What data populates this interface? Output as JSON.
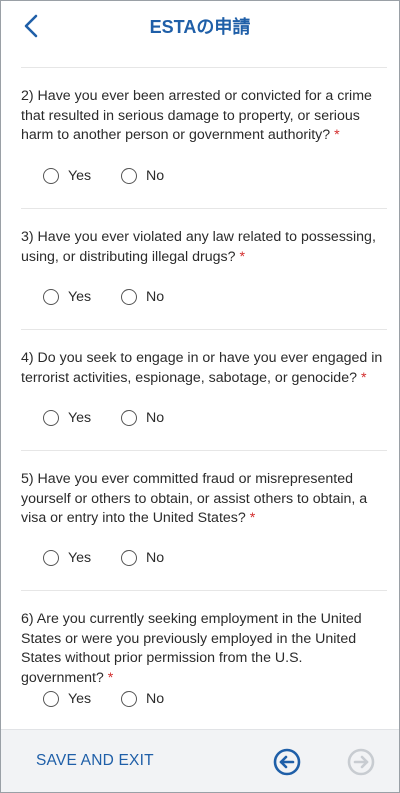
{
  "header": {
    "title": "ESTAの申請"
  },
  "questions": [
    {
      "text": "2) Have you ever been arrested or convicted for a crime that resulted in serious damage to property, or serious harm to another person or government authority?",
      "required_mark": "*",
      "options": [
        "Yes",
        "No"
      ]
    },
    {
      "text": "3) Have you ever violated any law related to possessing, using, or distributing illegal drugs?",
      "required_mark": "*",
      "options": [
        "Yes",
        "No"
      ]
    },
    {
      "text": "4) Do you seek to engage in or have you ever engaged in terrorist activities, espionage, sabotage, or genocide?",
      "required_mark": "*",
      "options": [
        "Yes",
        "No"
      ]
    },
    {
      "text": "5) Have you ever committed fraud or misrepresented yourself or others to obtain, or assist others to obtain, a visa or entry into the United States?",
      "required_mark": "*",
      "options": [
        "Yes",
        "No"
      ]
    },
    {
      "text": "6) Are you currently seeking employment in the United States or were you previously employed in the United States without prior permission from the U.S. government?",
      "required_mark": "*",
      "options": [
        "Yes",
        "No"
      ]
    }
  ],
  "footer": {
    "save_label": "SAVE AND EXIT",
    "prev_icon": "arrow-left-circle-icon",
    "next_icon": "arrow-right-circle-icon"
  },
  "colors": {
    "accent": "#1f5fa8",
    "required": "#d32f2f",
    "footer_bg": "#f2f3f5",
    "disabled": "#c8ccd1"
  }
}
